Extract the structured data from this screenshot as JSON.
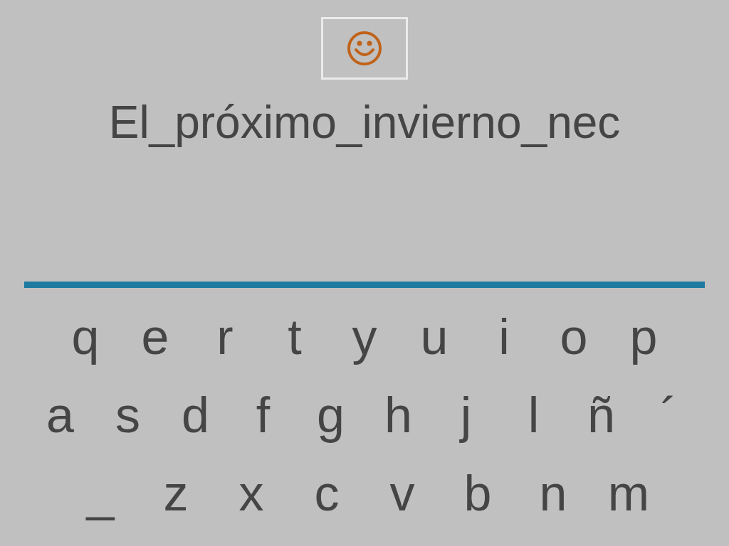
{
  "feedback": {
    "kind": "smiley"
  },
  "phrase": "El_próximo_invierno_nec",
  "keyboard": {
    "rows": [
      [
        "q",
        "e",
        "r",
        "t",
        "y",
        "u",
        "i",
        "o",
        "p"
      ],
      [
        "a",
        "s",
        "d",
        "f",
        "g",
        "h",
        "j",
        "l",
        "ñ",
        "´"
      ],
      [
        "_",
        "z",
        "x",
        "c",
        "v",
        "b",
        "n",
        "m"
      ]
    ]
  }
}
